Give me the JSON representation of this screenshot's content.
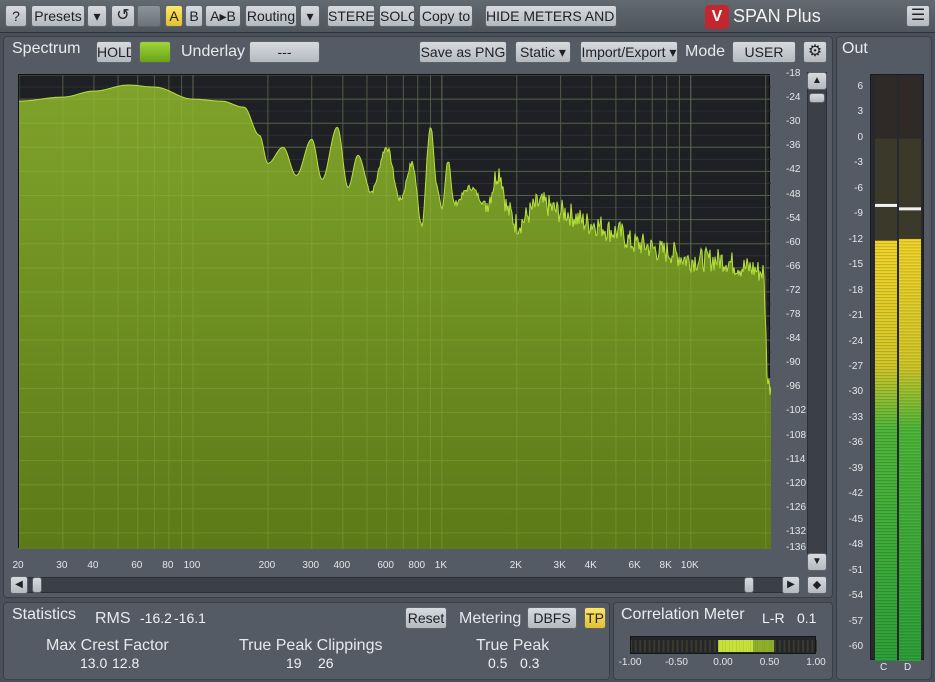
{
  "toolbar": {
    "help": "?",
    "presets": "Presets",
    "menu_arrow": "▾",
    "undo": "↺",
    "ab_a": "A",
    "ab_b": "B",
    "ab_copy": "A▸B",
    "routing": "Routing",
    "stereo": "STEREO",
    "solo": "SOLO",
    "copy_to": "Copy to",
    "hide_meters": "HIDE METERS AND STATS",
    "app_title": "SPAN Plus",
    "hamburger": "☰"
  },
  "spectrum": {
    "title": "Spectrum",
    "hold": "HOLD",
    "underlay_label": "Underlay",
    "underlay_value": "---",
    "save_png": "Save as PNG",
    "static": "Static ▾",
    "import_export": "Import/Export ▾",
    "mode_label": "Mode",
    "mode_value": "USER",
    "y_ticks": [
      "-18",
      "-24",
      "-30",
      "-36",
      "-42",
      "-48",
      "-54",
      "-60",
      "-66",
      "-72",
      "-78",
      "-84",
      "-90",
      "-96",
      "-102",
      "-108",
      "-114",
      "-120",
      "-126",
      "-132",
      "-136"
    ],
    "x_ticks": [
      "20",
      "30",
      "40",
      "60",
      "80",
      "100",
      "200",
      "300",
      "400",
      "600",
      "800",
      "1K",
      "2K",
      "3K",
      "4K",
      "6K",
      "8K",
      "10K"
    ],
    "colors": {
      "fill": "#6f8f1c",
      "stroke": "#b8e23a",
      "bg": "#1e2024"
    }
  },
  "out": {
    "title": "Out",
    "ticks": [
      "6",
      "3",
      "0",
      "-3",
      "-6",
      "-9",
      "-12",
      "-15",
      "-18",
      "-21",
      "-24",
      "-27",
      "-30",
      "-33",
      "-36",
      "-39",
      "-42",
      "-45",
      "-48",
      "-51",
      "-54",
      "-57",
      "-60"
    ],
    "channels": [
      "C",
      "D"
    ],
    "levels_db": [
      -12.0,
      -11.8
    ],
    "peak_db": [
      -7.8,
      -8.2
    ]
  },
  "statistics": {
    "title": "Statistics",
    "rms_label": "RMS",
    "rms_l": "-16.2",
    "rms_r": "-16.1",
    "reset": "Reset",
    "metering_label": "Metering",
    "metering_value": "DBFS",
    "tp": "TP",
    "max_crest_label": "Max Crest Factor",
    "max_crest_l": "13.0",
    "max_crest_r": "12.8",
    "tp_clip_label": "True Peak Clippings",
    "tp_clip_l": "19",
    "tp_clip_r": "26",
    "true_peak_label": "True Peak",
    "true_peak_l": "0.5",
    "true_peak_r": "0.3"
  },
  "correlation": {
    "title": "Correlation Meter",
    "mode": "L-R",
    "value": "0.1",
    "ticks": [
      "-1.00",
      "-0.50",
      "0.00",
      "0.50",
      "1.00"
    ]
  }
}
